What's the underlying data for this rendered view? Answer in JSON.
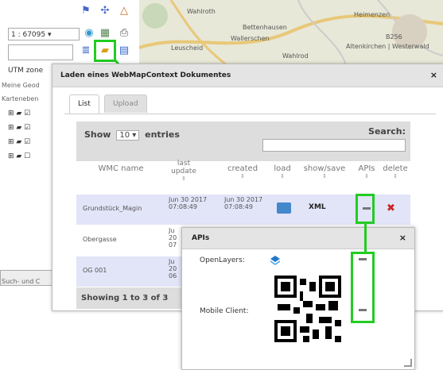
{
  "toolbar": {
    "scale": "1 : 67095",
    "utm_zone": "UTM zone"
  },
  "map": {
    "labels": [
      "Heimenzen",
      "Wahlroth",
      "B256",
      "Bettenhausen",
      "Wallerschen",
      "Altenkirchen | Westerwald",
      "Leuscheid",
      "Wahlrod"
    ]
  },
  "sidebar": {
    "text1": "Meine Geod",
    "text2": "Karteneben",
    "bottom_text": "Such- und C"
  },
  "dialog": {
    "title": "Laden eines WebMapContext Dokumentes",
    "close": "×",
    "tabs": [
      "List",
      "Upload"
    ],
    "show_prefix": "Show",
    "show_value": "10",
    "show_suffix": "entries",
    "search_label": "Search:",
    "columns": [
      "WMC name",
      "last update",
      "created",
      "load",
      "show/save",
      "APIs",
      "delete"
    ],
    "rows": [
      {
        "name": "Grundstück_Magin",
        "last_update": "Jun 30 2017 07:08:49",
        "created": "Jun 30 2017 07:08:49"
      },
      {
        "name": "Obergasse",
        "last_update": "Ju 20 07",
        "created": ""
      },
      {
        "name": "OG 001",
        "last_update": "Ju 20 06",
        "created": ""
      }
    ],
    "xml_label": "XML",
    "footer": "Showing 1 to 3 of 3"
  },
  "apis_popup": {
    "title": "APIs",
    "close": "×",
    "openlayers_label": "OpenLayers:",
    "mobile_label": "Mobile Client:"
  },
  "colors": {
    "highlight": "#22cc22",
    "row_alt": "#e2e4f8",
    "header_bg": "#e4e4e4"
  }
}
